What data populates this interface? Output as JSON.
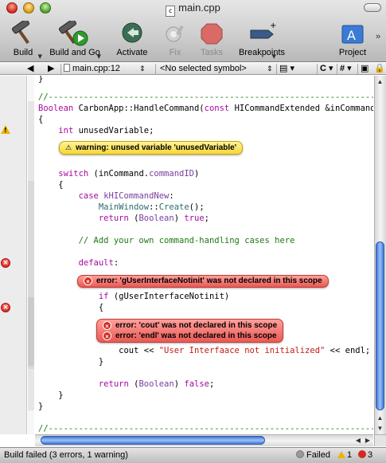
{
  "window": {
    "title": "main.cpp",
    "file_icon": "c-source-file-icon"
  },
  "toolbar": {
    "build": "Build",
    "build_and_go": "Build and Go",
    "activate": "Activate",
    "fix": "Fix",
    "tasks": "Tasks",
    "breakpoints": "Breakpoints",
    "project": "Project"
  },
  "navbar": {
    "file": "main.cpp:12",
    "symbol": "<No selected symbol>",
    "lang": "C",
    "include": "#"
  },
  "code": {
    "dashes": "//------------------------------------------------------------------------",
    "l_sig_kw": "Boolean",
    "l_sig_a": " CarbonApp::HandleCommand(",
    "l_sig_kw2": "const",
    "l_sig_b": " HICommandExtended &inCommand)",
    "l_brace_open": "{",
    "l_int_kw": "int",
    "l_int_rest": " unusedVariable;",
    "l_switch_kw": "switch",
    "l_switch_a": " (inCommand.",
    "l_switch_b": "commandID",
    "l_switch_c": ")",
    "l_sw_brace": "{",
    "l_case_kw": "case",
    "l_case_val": " kHICommandNew",
    "l_case_colon": ":",
    "l_main_a": "MainWindow",
    "l_main_b": "::",
    "l_main_c": "Create",
    "l_main_d": "();",
    "l_ret1_kw": "return",
    "l_ret1_a": " (",
    "l_ret1_b": "Boolean",
    "l_ret1_c": ") ",
    "l_ret1_d": "true",
    "l_ret1_e": ";",
    "l_comment": "// Add your own command-handling cases here",
    "l_default_kw": "default",
    "l_default_colon": ":",
    "l_if_kw": "if",
    "l_if_rest": " (gUserInterfaceNotinit)",
    "l_if_brace": "{",
    "l_cout_a": "cout << ",
    "l_cout_str": "\"User Interfaace not initialized\"",
    "l_cout_b": " << endl;",
    "l_if_close": "}",
    "l_ret2_kw": "return",
    "l_ret2_a": " (",
    "l_ret2_b": "Boolean",
    "l_ret2_c": ") ",
    "l_ret2_d": "false",
    "l_ret2_e": ";",
    "l_sw_close": "}",
    "l_fn_close": "}",
    "l_top_brace": "}"
  },
  "messages": {
    "warning": "warning: unused variable 'unusedVariable'",
    "error1": "error: 'gUserInterfaceNotinit' was not declared in this scope",
    "error2": "error: 'cout' was not declared in this scope",
    "error3": "error: 'endl' was not declared in this scope"
  },
  "status": {
    "text": "Build failed (3 errors, 1 warning)",
    "failed": "Failed",
    "warnings": "1",
    "errors": "3"
  }
}
